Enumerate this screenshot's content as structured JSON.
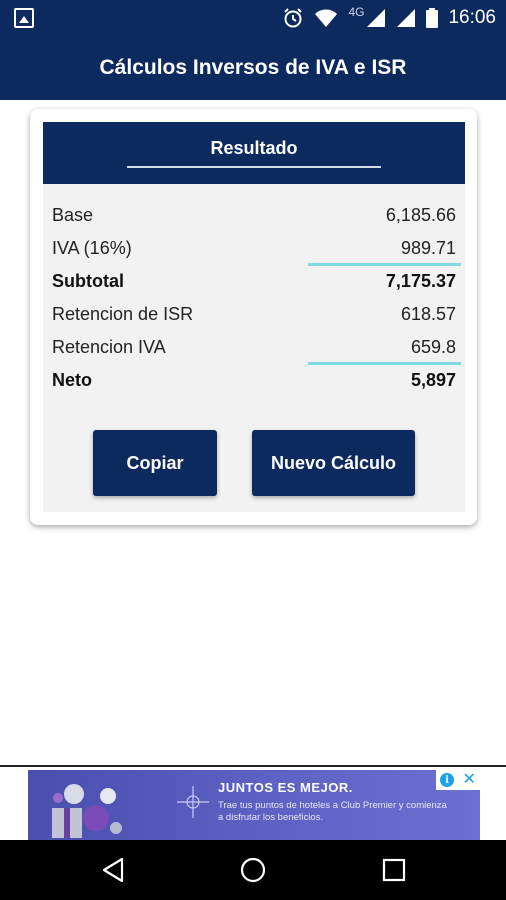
{
  "status_bar": {
    "time": "16:06",
    "network": "4G",
    "icons": [
      "image-icon",
      "alarm-icon",
      "wifi-icon",
      "signal-icon",
      "battery-icon"
    ]
  },
  "app_bar": {
    "title": "Cálculos Inversos de IVA e ISR"
  },
  "result": {
    "title": "Resultado",
    "rows": [
      {
        "label": "Base",
        "value": "6,185.66",
        "bold": false
      },
      {
        "label": "IVA (16%)",
        "value": "989.71",
        "bold": false
      },
      {
        "label": "Subtotal",
        "value": "7,175.37",
        "bold": true
      },
      {
        "label": "Retencion de ISR",
        "value": "618.57",
        "bold": false
      },
      {
        "label": "Retencion IVA",
        "value": "659.8",
        "bold": false
      },
      {
        "label": "Neto",
        "value": "5,897",
        "bold": true
      }
    ],
    "copy_button": "Copiar",
    "new_button": "Nuevo Cálculo"
  },
  "ad": {
    "headline": "JUNTOS ES MEJOR.",
    "body": "Trae tus puntos de hoteles a Club Premier y comienza a disfrutar los beneficios."
  },
  "colors": {
    "primary": "#0c2a5e",
    "accent_line": "#7fdbe0",
    "card_inner": "#f2f2f2"
  }
}
